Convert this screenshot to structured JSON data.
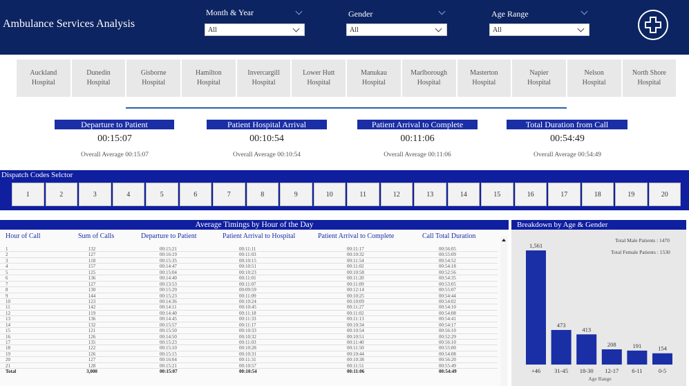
{
  "header": {
    "title": "Ambulance Services Analysis",
    "filters": [
      {
        "label": "Month & Year",
        "value": "All"
      },
      {
        "label": "Gender",
        "value": "All"
      },
      {
        "label": "Age Range",
        "value": "All"
      }
    ],
    "logo_icon": "ambulance-cross-icon"
  },
  "hospitals": [
    "Auckland\nHospital",
    "Dunedin\nHospital",
    "Gisborne\nHospital",
    "Hamilton\nHospital",
    "Invercargill\nHospital",
    "Lower Hutt\nHospital",
    "Manukau\nHospital",
    "Marlborough\nHospital",
    "Masterton\nHospital",
    "Napier\nHospital",
    "Nelson\nHospital",
    "North Shore\nHospital"
  ],
  "kpis": [
    {
      "title": "Departure to Patient",
      "value": "00:15:07",
      "average": "Overall Average 00:15:07"
    },
    {
      "title": "Patient Hospital Arrival",
      "value": "00:10:54",
      "average": "Overall Average 00:10:54"
    },
    {
      "title": "Patient Arrival to Complete",
      "value": "00:11:06",
      "average": "Overall Average 00:11:06"
    },
    {
      "title": "Total Duration from Call",
      "value": "00:54:49",
      "average": "Overall Average 00:54:49"
    }
  ],
  "dispatch": {
    "title": "Dispatch Codes Selctor",
    "codes": [
      "1",
      "2",
      "3",
      "4",
      "5",
      "6",
      "7",
      "8",
      "9",
      "10",
      "11",
      "12",
      "13",
      "14",
      "15",
      "16",
      "17",
      "18",
      "19",
      "20"
    ]
  },
  "table": {
    "title": "Average Timings by Hour of the Day",
    "columns": [
      "Hour of Call",
      "Sum of Calls",
      "Departure to Patient",
      "Patient Arrival to Hospital",
      "Patient Arrival to Complete",
      "Call Total Duration"
    ],
    "rows": [
      [
        "1",
        "132",
        "00:15:21",
        "00:11:11",
        "00:11:17",
        "00:56:05"
      ],
      [
        "2",
        "127",
        "00:16:19",
        "00:11:03",
        "00:10:32",
        "00:55:09"
      ],
      [
        "3",
        "118",
        "00:15:35",
        "00:10:15",
        "00:11:54",
        "00:54:52"
      ],
      [
        "4",
        "157",
        "00:14:47",
        "00:10:51",
        "00:11:02",
        "00:54:18"
      ],
      [
        "5",
        "125",
        "00:15:04",
        "00:10:23",
        "00:10:58",
        "00:52:56"
      ],
      [
        "6",
        "136",
        "00:14:40",
        "00:11:01",
        "00:11:20",
        "00:54:35"
      ],
      [
        "7",
        "127",
        "00:13:53",
        "00:11:07",
        "00:11:09",
        "00:53:05"
      ],
      [
        "8",
        "130",
        "00:15:29",
        "00:09:59",
        "00:12:14",
        "00:55:07"
      ],
      [
        "9",
        "144",
        "00:15:23",
        "00:11:09",
        "00:10:25",
        "00:54:44"
      ],
      [
        "10",
        "123",
        "00:14:36",
        "00:10:24",
        "00:10:09",
        "00:54:02"
      ],
      [
        "11",
        "142",
        "00:14:11",
        "00:10:45",
        "00:11:27",
        "00:54:10"
      ],
      [
        "12",
        "119",
        "00:14:40",
        "00:11:18",
        "00:11:02",
        "00:54:08"
      ],
      [
        "13",
        "136",
        "00:14:45",
        "00:11:33",
        "00:11:13",
        "00:54:41"
      ],
      [
        "14",
        "132",
        "00:15:57",
        "00:11:17",
        "00:10:34",
        "00:54:17"
      ],
      [
        "15",
        "121",
        "00:15:50",
        "00:10:33",
        "00:10:54",
        "00:56:10"
      ],
      [
        "16",
        "126",
        "00:14:50",
        "00:10:32",
        "00:10:51",
        "00:52:29"
      ],
      [
        "17",
        "135",
        "00:15:23",
        "00:11:03",
        "00:11:40",
        "00:56:10"
      ],
      [
        "18",
        "122",
        "00:15:10",
        "00:10:28",
        "00:11:50",
        "00:55:00"
      ],
      [
        "19",
        "126",
        "00:15:15",
        "00:10:31",
        "00:10:44",
        "00:54:08"
      ],
      [
        "20",
        "127",
        "00:16:04",
        "00:11:31",
        "00:10:38",
        "00:56:20"
      ],
      [
        "21",
        "128",
        "00:15:21",
        "00:10:57",
        "00:11:51",
        "00:55:49"
      ]
    ],
    "total": [
      "Total",
      "3,000",
      "00:15:07",
      "00:10:54",
      "00:11:06",
      "00:54:49"
    ]
  },
  "breakdown": {
    "title": "Breakdown by Age & Gender",
    "total_male": "Total Male Patients : 1470",
    "total_female": "Total Female Patients : 1530"
  },
  "chart_data": {
    "type": "bar",
    "title": "Breakdown by Age & Gender",
    "categories": [
      "+46",
      "31-45",
      "18-30",
      "12-17",
      "6-11",
      "0-5"
    ],
    "values": [
      1561,
      473,
      413,
      208,
      191,
      154
    ],
    "xlabel": "Age Range",
    "ylabel": "",
    "ylim": [
      0,
      1561
    ],
    "color": "#1a2ea6"
  },
  "colors": {
    "header_bg": "#0c2461",
    "accent": "#0f1fa0",
    "kpi_title_bg": "#1a2ea6",
    "bar": "#1a2ea6"
  }
}
